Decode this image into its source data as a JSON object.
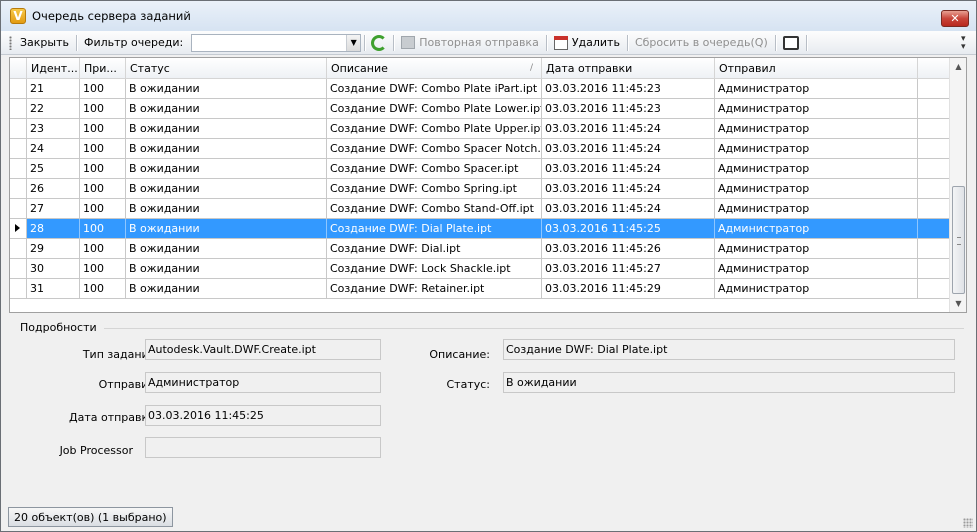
{
  "window": {
    "title": "Очередь сервера заданий",
    "app_icon": "V",
    "close_glyph": "✕"
  },
  "toolbar": {
    "close_label": "Закрыть",
    "filter_label": "Фильтр очереди:",
    "filter_value": "",
    "resend_label": "Повторная отправка",
    "delete_label": "Удалить",
    "reset_label": "Сбросить в очередь(Q)"
  },
  "grid": {
    "columns": [
      "Идент...",
      "При...",
      "Статус",
      "Описание",
      "Дата отправки",
      "Отправил"
    ],
    "sort_glyph": "/",
    "rows": [
      {
        "id": "21",
        "priority": "100",
        "status": "В ожидании",
        "description": "Создание DWF: Combo Plate iPart.ipt",
        "date": "03.03.2016 11:45:23",
        "sender": "Администратор"
      },
      {
        "id": "22",
        "priority": "100",
        "status": "В ожидании",
        "description": "Создание DWF: Combo Plate Lower.ipt",
        "date": "03.03.2016 11:45:23",
        "sender": "Администратор"
      },
      {
        "id": "23",
        "priority": "100",
        "status": "В ожидании",
        "description": "Создание DWF: Combo Plate Upper.ipt",
        "date": "03.03.2016 11:45:24",
        "sender": "Администратор"
      },
      {
        "id": "24",
        "priority": "100",
        "status": "В ожидании",
        "description": "Создание DWF: Combo Spacer Notch...",
        "date": "03.03.2016 11:45:24",
        "sender": "Администратор"
      },
      {
        "id": "25",
        "priority": "100",
        "status": "В ожидании",
        "description": "Создание DWF: Combo Spacer.ipt",
        "date": "03.03.2016 11:45:24",
        "sender": "Администратор"
      },
      {
        "id": "26",
        "priority": "100",
        "status": "В ожидании",
        "description": "Создание DWF: Combo Spring.ipt",
        "date": "03.03.2016 11:45:24",
        "sender": "Администратор"
      },
      {
        "id": "27",
        "priority": "100",
        "status": "В ожидании",
        "description": "Создание DWF: Combo Stand-Off.ipt",
        "date": "03.03.2016 11:45:24",
        "sender": "Администратор"
      },
      {
        "id": "28",
        "priority": "100",
        "status": "В ожидании",
        "description": "Создание DWF: Dial Plate.ipt",
        "date": "03.03.2016 11:45:25",
        "sender": "Администратор"
      },
      {
        "id": "29",
        "priority": "100",
        "status": "В ожидании",
        "description": "Создание DWF: Dial.ipt",
        "date": "03.03.2016 11:45:26",
        "sender": "Администратор"
      },
      {
        "id": "30",
        "priority": "100",
        "status": "В ожидании",
        "description": "Создание DWF: Lock Shackle.ipt",
        "date": "03.03.2016 11:45:27",
        "sender": "Администратор"
      },
      {
        "id": "31",
        "priority": "100",
        "status": "В ожидании",
        "description": "Создание DWF: Retainer.ipt",
        "date": "03.03.2016 11:45:29",
        "sender": "Администратор"
      }
    ],
    "selected_row_id": "28",
    "colors": {
      "selection": "#3399ff"
    }
  },
  "details": {
    "title": "Подробности",
    "job_type_label": "Тип задания:",
    "job_type_value": "Autodesk.Vault.DWF.Create.ipt",
    "sender_label": "Отправил:",
    "sender_value": "Администратор",
    "date_label": "Дата отправки:",
    "date_value": "03.03.2016 11:45:25",
    "processor_label": "Job Processor",
    "processor_value": "",
    "description_label": "Описание:",
    "description_value": "Создание DWF: Dial Plate.ipt",
    "status_label": "Статус:",
    "status_value": "В ожидании"
  },
  "statusbar": {
    "text": "20 объект(ов) (1 выбрано)"
  },
  "icons": [
    "app-icon",
    "close-icon",
    "grip-icon",
    "combo-dropdown-icon",
    "refresh-icon",
    "resend-icon",
    "delete-icon",
    "print-icon",
    "overflow-icon",
    "row-selector-icon",
    "sort-indicator-icon",
    "scroll-up-icon",
    "scroll-down-icon",
    "resize-grip-icon"
  ]
}
